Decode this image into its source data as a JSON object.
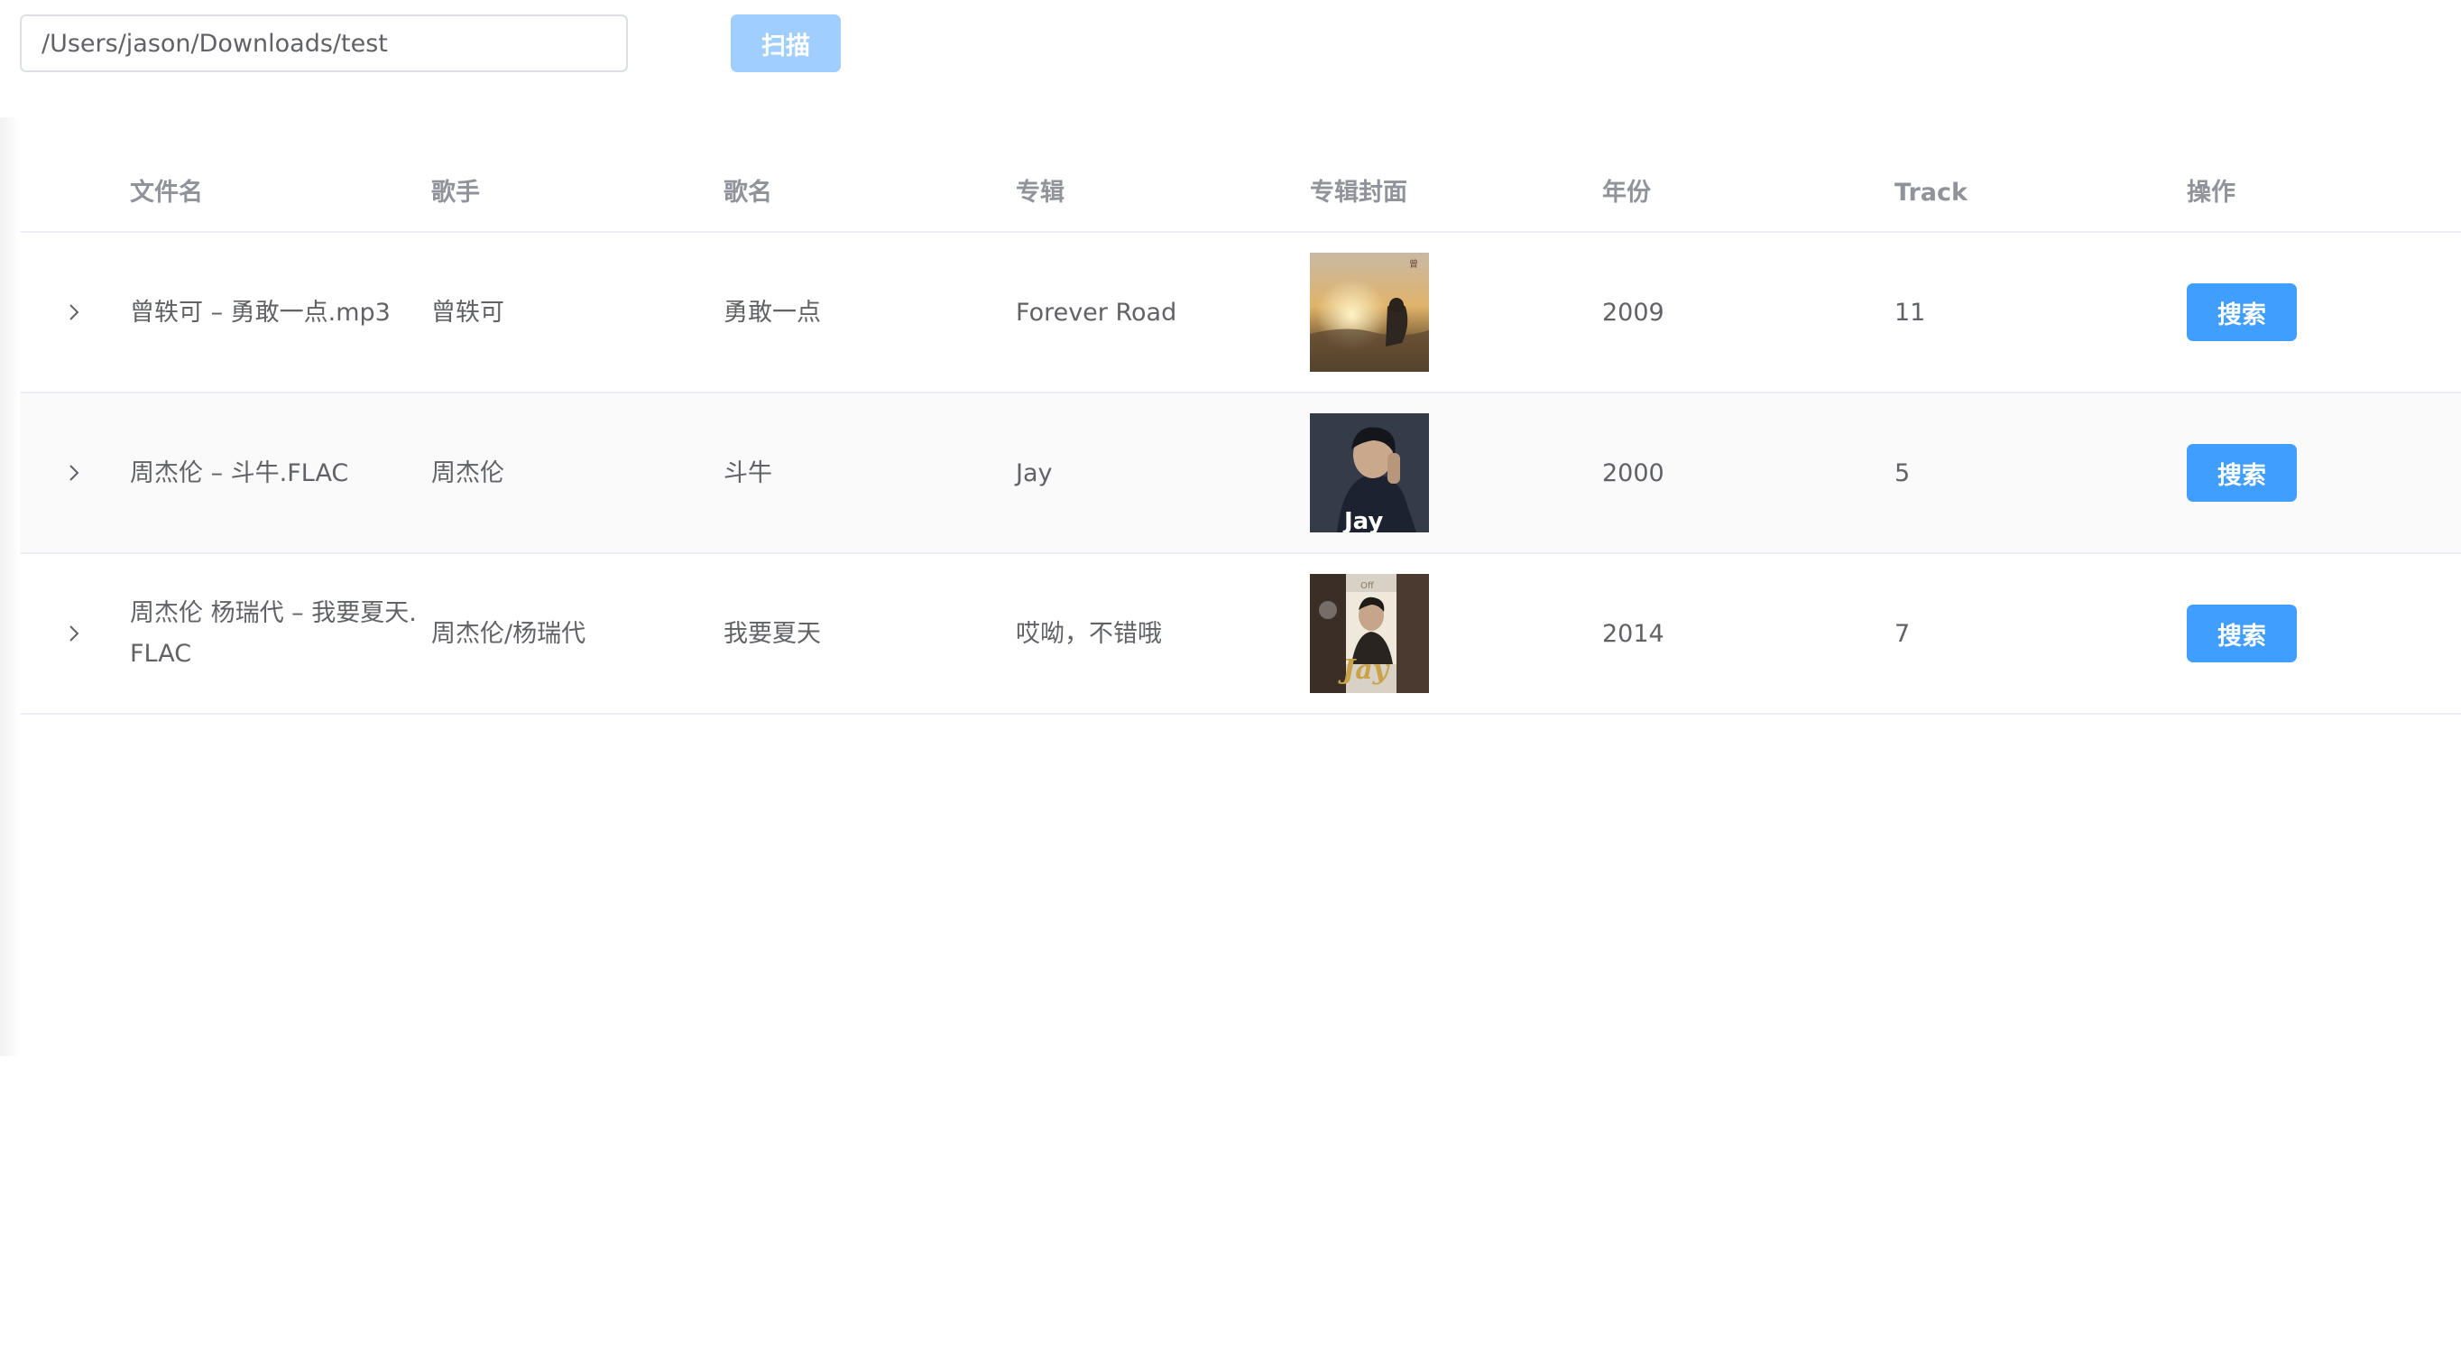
{
  "toolbar": {
    "path_value": "/Users/jason/Downloads/test",
    "scan_label": "扫描"
  },
  "table": {
    "headers": {
      "filename": "文件名",
      "singer": "歌手",
      "song": "歌名",
      "album": "专辑",
      "cover": "专辑封面",
      "year": "年份",
      "track": "Track",
      "action": "操作"
    },
    "rows": [
      {
        "filename": "曾轶可 – 勇敢一点.mp3",
        "singer": "曾轶可",
        "song": "勇敢一点",
        "album": "Forever Road",
        "year": "2009",
        "track": "11",
        "action_label": "搜索",
        "cover_icon": "album-cover-sunset"
      },
      {
        "filename": "周杰伦 – 斗牛.FLAC",
        "singer": "周杰伦",
        "song": "斗牛",
        "album": "Jay",
        "year": "2000",
        "track": "5",
        "action_label": "搜索",
        "cover_icon": "album-cover-portrait",
        "cover_text": "Jay"
      },
      {
        "filename": "周杰伦 杨瑞代 – 我要夏天.FLAC",
        "singer": "周杰伦/杨瑞代",
        "song": "我要夏天",
        "album": "哎呦，不错哦",
        "year": "2014",
        "track": "7",
        "action_label": "搜索",
        "cover_icon": "album-cover-collage",
        "cover_text": "Jay"
      }
    ]
  },
  "colors": {
    "primary": "#409eff",
    "primary_light": "#a0cfff",
    "border": "#ebeef5",
    "header_text": "#909399",
    "body_text": "#606266"
  }
}
